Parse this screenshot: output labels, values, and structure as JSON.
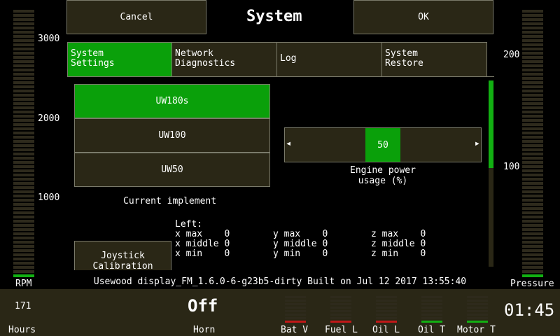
{
  "header": {
    "cancel_label": "Cancel",
    "title": "System",
    "ok_label": "OK"
  },
  "tabs": [
    {
      "label": "System\nSettings",
      "active": true
    },
    {
      "label": "Network\nDiagnostics",
      "active": false
    },
    {
      "label": "Log",
      "active": false
    },
    {
      "label": "System\nRestore",
      "active": false
    }
  ],
  "implements": {
    "items": [
      "UW180s",
      "UW100",
      "UW50"
    ],
    "selected": "UW180s",
    "caption": "Current implement"
  },
  "power": {
    "value": "50",
    "left_arrow": "◂",
    "right_arrow": "▸",
    "caption_line1": "Engine power",
    "caption_line2": "usage (%)"
  },
  "joystick": {
    "button_label": "Joystick Calibration",
    "side_label": "Left:",
    "rows": [
      [
        "x max    0",
        "y max    0",
        "z max    0"
      ],
      [
        "x middle 0",
        "y middle 0",
        "z middle 0"
      ],
      [
        "x min    0",
        "y min    0",
        "z min    0"
      ]
    ]
  },
  "rpm_gauge": {
    "ticks": [
      "3000",
      "2000",
      "1000"
    ],
    "label": "RPM",
    "lit_fraction": 0.02
  },
  "pressure_gauge": {
    "ticks": [
      "200",
      "100"
    ],
    "label": "Pressure",
    "lit_fraction": 0.02
  },
  "footer": {
    "build_text": "Usewood display_FM_1.6.0-6-g23b5-dirty Built on Jul 12 2017 13:55:40",
    "hours_value": "171",
    "hours_label": "Hours",
    "horn_value": "Off",
    "horn_label": "Horn",
    "time": "01:45",
    "indicators": [
      {
        "label": "Bat V",
        "state": "red"
      },
      {
        "label": "Fuel L",
        "state": "red"
      },
      {
        "label": "Oil L",
        "state": "red"
      },
      {
        "label": "Oil T",
        "state": "green"
      },
      {
        "label": "Motor T",
        "state": "green"
      }
    ]
  },
  "colors": {
    "accent_green": "#0aa00a",
    "panel_bg": "#2a2716",
    "warn_red": "#c01818"
  }
}
